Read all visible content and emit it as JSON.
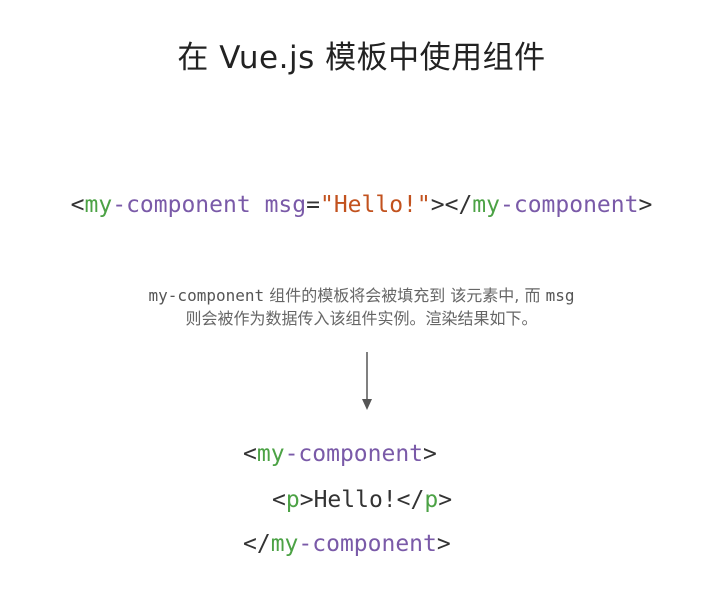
{
  "title": "在 Vue.js 模板中使用组件",
  "template_line": {
    "open_lt": "<",
    "tag_a": "my",
    "tag_b": "-component",
    "space": " ",
    "attr": "msg",
    "eq": "=",
    "value": "\"Hello!\"",
    "close_gt": "></",
    "end_tag_a": "my",
    "end_tag_b": "-component",
    "end_gt": ">"
  },
  "description": {
    "line1_code": "my-component",
    "line1_text": " 组件的模板将会被填充到 该元素中, 而 ",
    "line1_code2": "msg",
    "line2_text": "则会被作为数据传入该组件实例。渲染结果如下。"
  },
  "output": {
    "line1": {
      "lt": "<",
      "tag_a": "my",
      "tag_b": "-component",
      "gt": ">"
    },
    "line2": {
      "lt": "<",
      "tag": "p",
      "gt_text": ">Hello!</",
      "tag2": "p",
      "gt": ">"
    },
    "line3": {
      "lt": "</",
      "tag_a": "my",
      "tag_b": "-component",
      "gt": ">"
    }
  }
}
